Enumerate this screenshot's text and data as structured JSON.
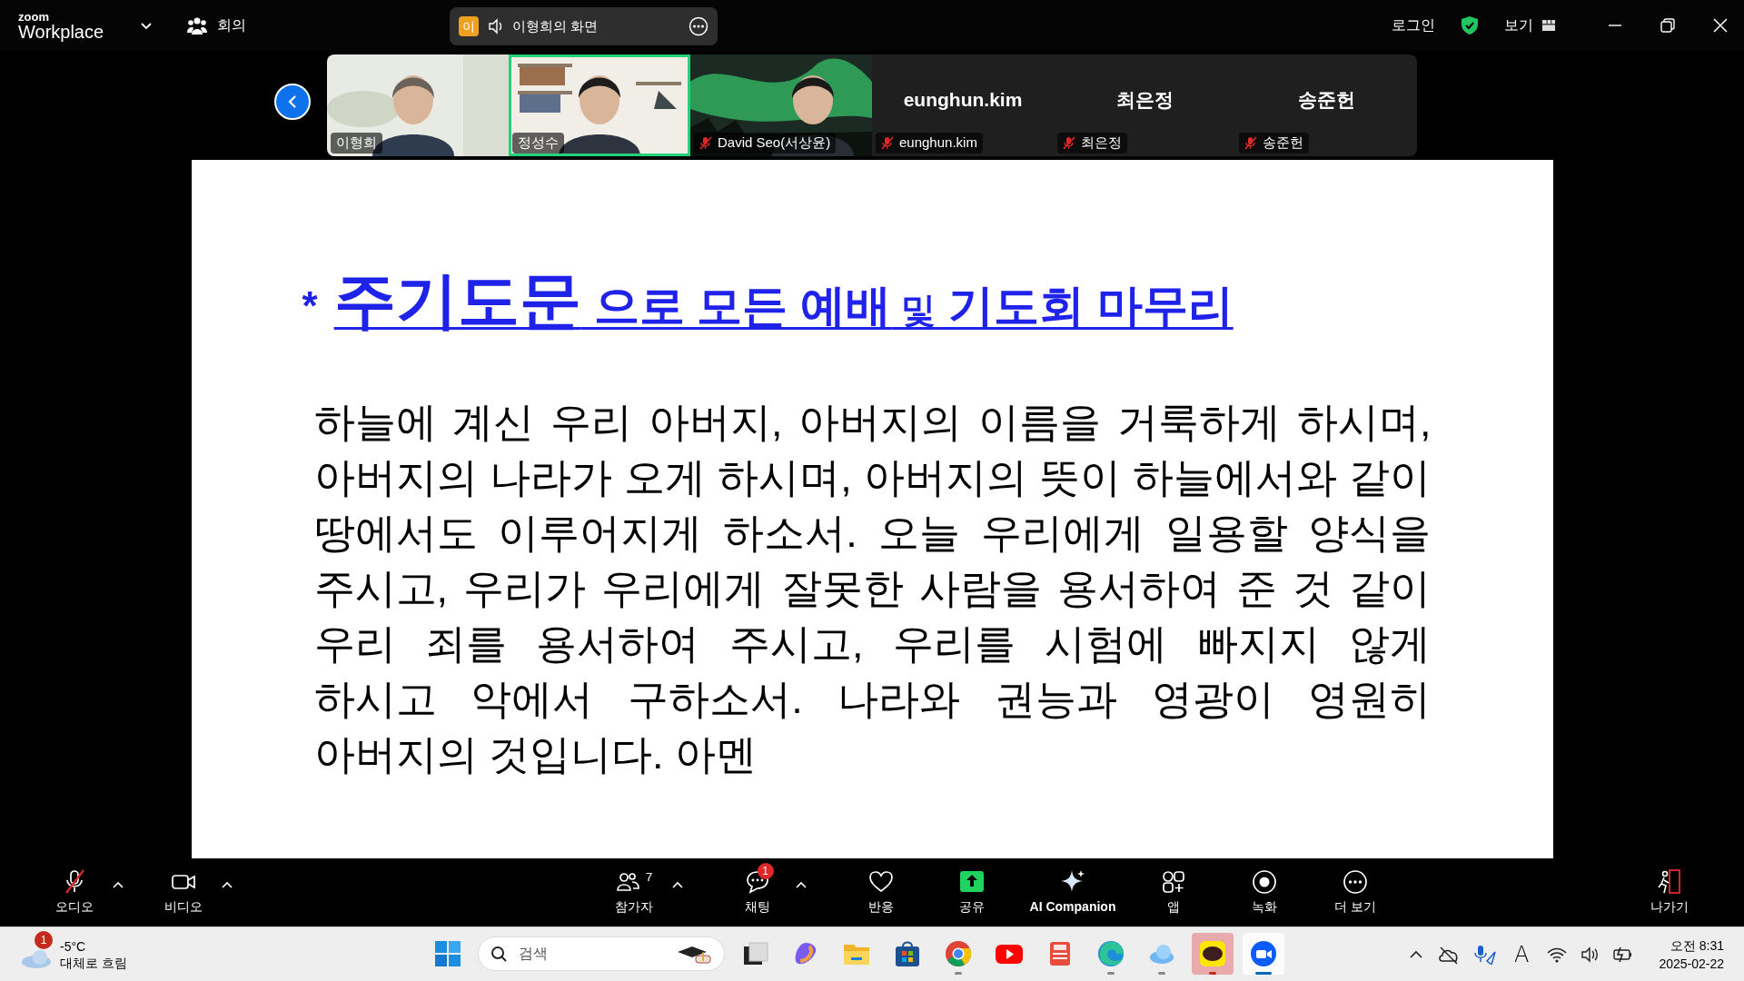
{
  "app": {
    "logo_top": "zoom",
    "logo_bottom": "Workplace",
    "meeting_label": "회의"
  },
  "share_banner": {
    "badge": "이",
    "title": "이형희의 화면"
  },
  "header_right": {
    "login": "로그인",
    "view": "보기"
  },
  "participants": [
    {
      "name": "이형희",
      "kind": "video",
      "muted": false,
      "speaking": false
    },
    {
      "name": "정성수",
      "kind": "video",
      "muted": false,
      "speaking": true
    },
    {
      "name": "David Seo(서상윤)",
      "kind": "video",
      "muted": true,
      "speaking": false
    },
    {
      "name": "eunghun.kim",
      "display_name": "eunghun.kim",
      "kind": "name",
      "muted": true,
      "speaking": false
    },
    {
      "name": "최은정",
      "display_name": "최은정",
      "kind": "name",
      "muted": true,
      "speaking": false
    },
    {
      "name": "송준헌",
      "display_name": "송준헌",
      "kind": "name",
      "muted": true,
      "speaking": false
    }
  ],
  "slide": {
    "marker": "*",
    "title_parts": [
      {
        "text": "주기도문",
        "kind": "large"
      },
      {
        "text": "으로 모든 예배",
        "kind": "normal"
      },
      {
        "text": "및",
        "kind": "small"
      },
      {
        "text": "기도회 마무리",
        "kind": "normal"
      }
    ],
    "lines": [
      "하늘에 계신 우리 아버지, 아버지의 이름을 거룩하게 하시며,",
      "아버지의 나라가 오게 하시며, 아버지의 뜻이 하늘에서와 같이",
      "땅에서도 이루어지게 하소서. 오늘 우리에게 일용할 양식을",
      "주시고, 우리가 우리에게 잘못한 사람을 용서하여 준 것 같이",
      "우리 죄를 용서하여 주시고, 우리를 시험에 빠지지 않게",
      "하시고 악에서 구하소서. 나라와 권능과 영광이 영원히",
      "아버지의 것입니다. 아멘"
    ]
  },
  "toolbar": {
    "left": [
      {
        "label": "오디오",
        "muted": true,
        "caret": true
      },
      {
        "label": "비디오",
        "muted": false,
        "caret": true
      }
    ],
    "center": [
      {
        "label": "참가자",
        "count": "7",
        "caret": true
      },
      {
        "label": "채팅",
        "badge": "1",
        "caret": true
      },
      {
        "label": "반응"
      },
      {
        "label": "공유"
      },
      {
        "label": "AI Companion"
      },
      {
        "label": "앱"
      },
      {
        "label": "녹화"
      },
      {
        "label": "더 보기"
      }
    ],
    "right": [
      {
        "label": "나가기"
      }
    ]
  },
  "taskbar": {
    "weather": {
      "badge": "1",
      "temp": "-5°C",
      "desc": "대체로 흐림"
    },
    "search_placeholder": "검색",
    "apps": [
      {
        "running": false,
        "selected": false,
        "attention": false
      },
      {
        "running": false,
        "selected": false,
        "attention": false
      },
      {
        "running": false,
        "selected": false,
        "attention": false
      },
      {
        "running": false,
        "selected": false,
        "attention": false
      },
      {
        "running": true,
        "selected": false,
        "attention": false
      },
      {
        "running": false,
        "selected": false,
        "attention": false
      },
      {
        "running": false,
        "selected": false,
        "attention": false
      },
      {
        "running": true,
        "selected": false,
        "attention": false
      },
      {
        "running": true,
        "selected": false,
        "attention": false
      },
      {
        "running": true,
        "selected": false,
        "attention": true
      },
      {
        "running": true,
        "selected": true,
        "attention": false
      }
    ],
    "ime": "A",
    "clock": {
      "time": "오전 8:31",
      "date": "2025-02-22"
    }
  }
}
